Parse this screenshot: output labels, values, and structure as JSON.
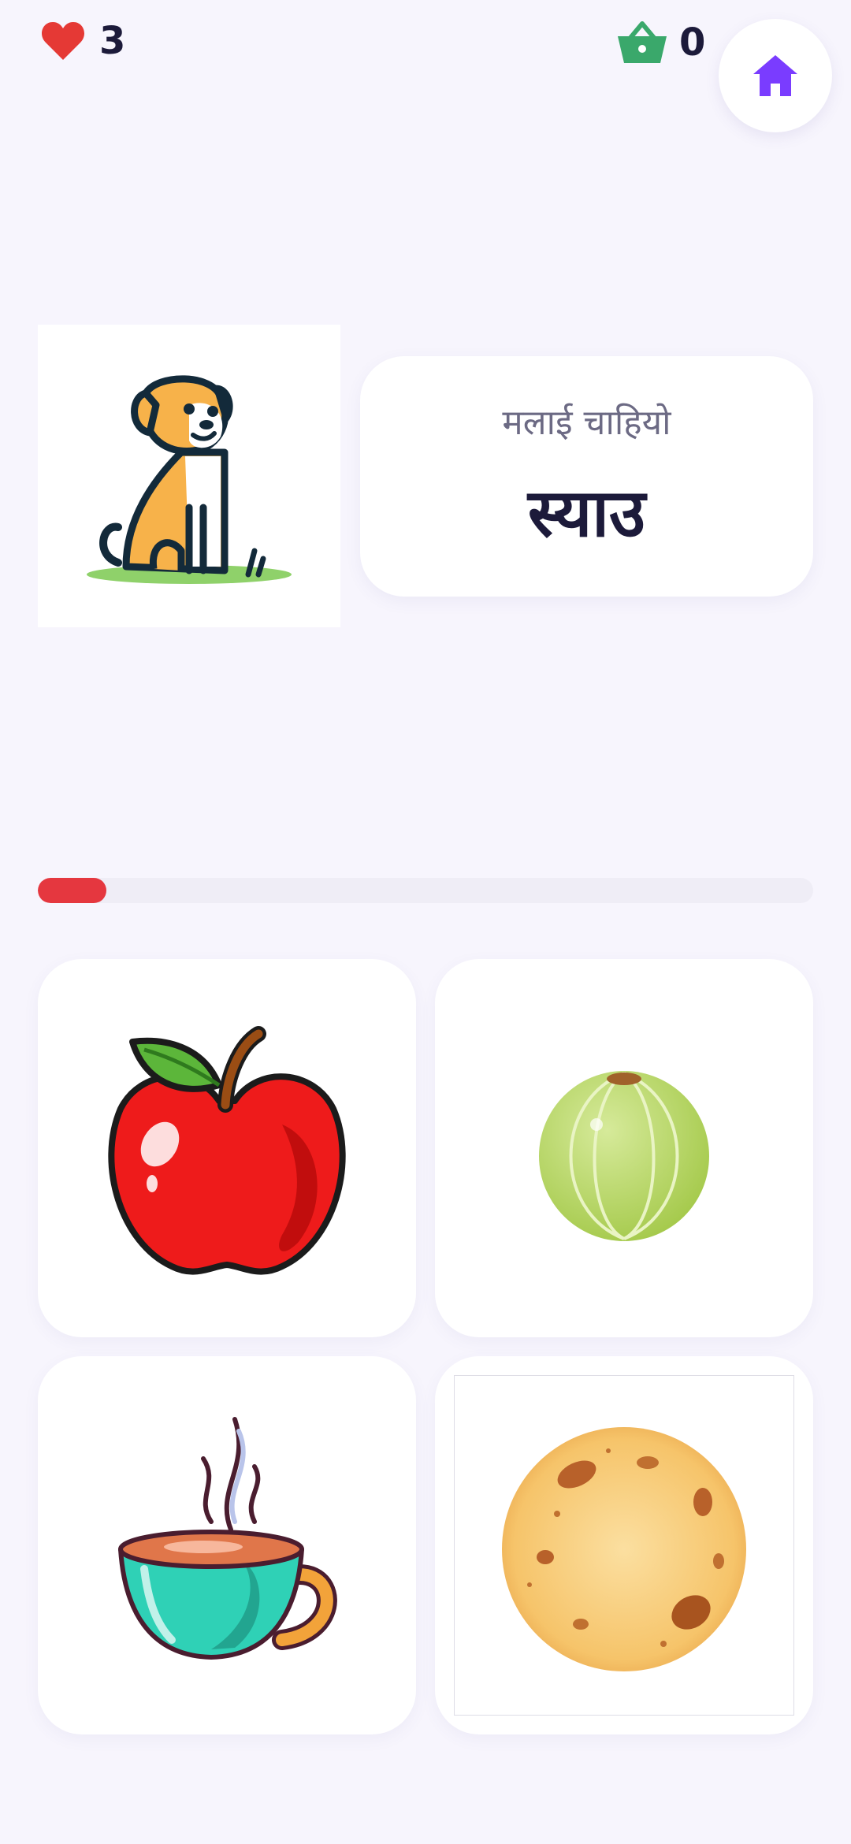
{
  "status": {
    "lives": "3",
    "basket_count": "0",
    "icons": {
      "lives": "heart-icon",
      "basket": "basket-icon",
      "home": "home-icon"
    },
    "colors": {
      "heart": "#e53935",
      "basket": "#3aa86b",
      "home": "#7a3cff"
    }
  },
  "prompt": {
    "image_icon": "dog-icon",
    "subtitle": "मलाई चाहियो",
    "word": "स्याउ"
  },
  "progress": {
    "fraction": 0.088,
    "color": "#e5373f"
  },
  "options": [
    {
      "icon": "apple-icon"
    },
    {
      "icon": "amla-icon"
    },
    {
      "icon": "tea-cup-icon"
    },
    {
      "icon": "roti-icon"
    }
  ]
}
